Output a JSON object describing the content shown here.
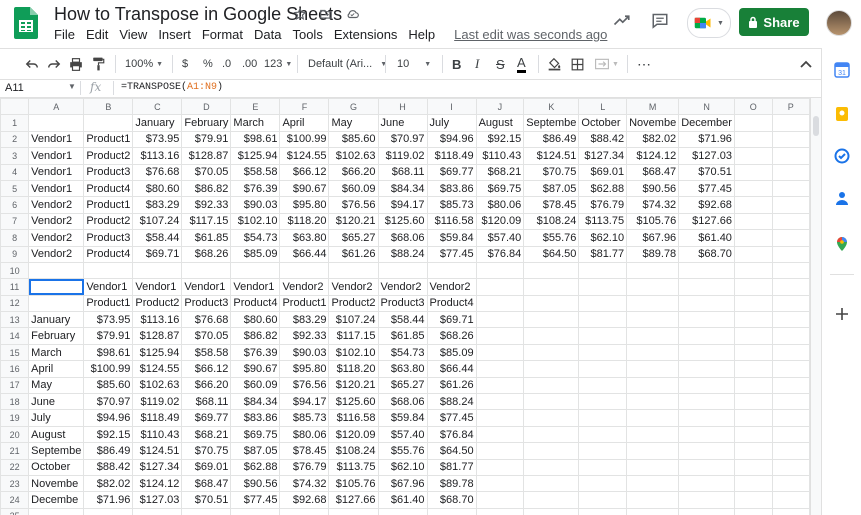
{
  "app": {
    "doc_title": "How to Transpose in Google Sheets",
    "menu": [
      "File",
      "Edit",
      "View",
      "Insert",
      "Format",
      "Data",
      "Tools",
      "Extensions",
      "Help"
    ],
    "last_edit": "Last edit was seconds ago",
    "share_label": "Share",
    "accent_color": "#188038"
  },
  "toolbar": {
    "zoom": "100%",
    "currency": "$",
    "percent": "%",
    "dec_decrease": ".0",
    "dec_increase": ".00",
    "more_formats": "123",
    "font": "Default (Ari...",
    "font_size": "10",
    "bold": "B",
    "italic": "I",
    "strike": "S",
    "text_color": "A"
  },
  "formula_bar": {
    "name_box": "A11",
    "fx": "fx",
    "formula_prefix": "=TRANSPOSE(",
    "formula_ref": "A1:N9",
    "formula_suffix": ")"
  },
  "grid": {
    "columns": [
      "A",
      "B",
      "C",
      "D",
      "E",
      "F",
      "G",
      "H",
      "I",
      "J",
      "K",
      "L",
      "M",
      "N",
      "O",
      "P"
    ],
    "selected_cell": "A11",
    "rows": [
      [
        "",
        "",
        "January",
        "February",
        "March",
        "April",
        "May",
        "June",
        "July",
        "August",
        "Septembe",
        "October",
        "Novembe",
        "December",
        "",
        ""
      ],
      [
        "Vendor1",
        "Product1",
        "$73.95",
        "$79.91",
        "$98.61",
        "$100.99",
        "$85.60",
        "$70.97",
        "$94.96",
        "$92.15",
        "$86.49",
        "$88.42",
        "$82.02",
        "$71.96",
        "",
        ""
      ],
      [
        "Vendor1",
        "Product2",
        "$113.16",
        "$128.87",
        "$125.94",
        "$124.55",
        "$102.63",
        "$119.02",
        "$118.49",
        "$110.43",
        "$124.51",
        "$127.34",
        "$124.12",
        "$127.03",
        "",
        ""
      ],
      [
        "Vendor1",
        "Product3",
        "$76.68",
        "$70.05",
        "$58.58",
        "$66.12",
        "$66.20",
        "$68.11",
        "$69.77",
        "$68.21",
        "$70.75",
        "$69.01",
        "$68.47",
        "$70.51",
        "",
        ""
      ],
      [
        "Vendor1",
        "Product4",
        "$80.60",
        "$86.82",
        "$76.39",
        "$90.67",
        "$60.09",
        "$84.34",
        "$83.86",
        "$69.75",
        "$87.05",
        "$62.88",
        "$90.56",
        "$77.45",
        "",
        ""
      ],
      [
        "Vendor2",
        "Product1",
        "$83.29",
        "$92.33",
        "$90.03",
        "$95.80",
        "$76.56",
        "$94.17",
        "$85.73",
        "$80.06",
        "$78.45",
        "$76.79",
        "$74.32",
        "$92.68",
        "",
        ""
      ],
      [
        "Vendor2",
        "Product2",
        "$107.24",
        "$117.15",
        "$102.10",
        "$118.20",
        "$120.21",
        "$125.60",
        "$116.58",
        "$120.09",
        "$108.24",
        "$113.75",
        "$105.76",
        "$127.66",
        "",
        ""
      ],
      [
        "Vendor2",
        "Product3",
        "$58.44",
        "$61.85",
        "$54.73",
        "$63.80",
        "$65.27",
        "$68.06",
        "$59.84",
        "$57.40",
        "$55.76",
        "$62.10",
        "$67.96",
        "$61.40",
        "",
        ""
      ],
      [
        "Vendor2",
        "Product4",
        "$69.71",
        "$68.26",
        "$85.09",
        "$66.44",
        "$61.26",
        "$88.24",
        "$77.45",
        "$76.84",
        "$64.50",
        "$81.77",
        "$89.78",
        "$68.70",
        "",
        ""
      ],
      [
        "",
        "",
        "",
        "",
        "",
        "",
        "",
        "",
        "",
        "",
        "",
        "",
        "",
        "",
        "",
        ""
      ],
      [
        "",
        "Vendor1",
        "Vendor1",
        "Vendor1",
        "Vendor1",
        "Vendor2",
        "Vendor2",
        "Vendor2",
        "Vendor2",
        "",
        "",
        "",
        "",
        "",
        "",
        ""
      ],
      [
        "",
        "Product1",
        "Product2",
        "Product3",
        "Product4",
        "Product1",
        "Product2",
        "Product3",
        "Product4",
        "",
        "",
        "",
        "",
        "",
        "",
        ""
      ],
      [
        "January",
        "$73.95",
        "$113.16",
        "$76.68",
        "$80.60",
        "$83.29",
        "$107.24",
        "$58.44",
        "$69.71",
        "",
        "",
        "",
        "",
        "",
        "",
        ""
      ],
      [
        "February",
        "$79.91",
        "$128.87",
        "$70.05",
        "$86.82",
        "$92.33",
        "$117.15",
        "$61.85",
        "$68.26",
        "",
        "",
        "",
        "",
        "",
        "",
        ""
      ],
      [
        "March",
        "$98.61",
        "$125.94",
        "$58.58",
        "$76.39",
        "$90.03",
        "$102.10",
        "$54.73",
        "$85.09",
        "",
        "",
        "",
        "",
        "",
        "",
        ""
      ],
      [
        "April",
        "$100.99",
        "$124.55",
        "$66.12",
        "$90.67",
        "$95.80",
        "$118.20",
        "$63.80",
        "$66.44",
        "",
        "",
        "",
        "",
        "",
        "",
        ""
      ],
      [
        "May",
        "$85.60",
        "$102.63",
        "$66.20",
        "$60.09",
        "$76.56",
        "$120.21",
        "$65.27",
        "$61.26",
        "",
        "",
        "",
        "",
        "",
        "",
        ""
      ],
      [
        "June",
        "$70.97",
        "$119.02",
        "$68.11",
        "$84.34",
        "$94.17",
        "$125.60",
        "$68.06",
        "$88.24",
        "",
        "",
        "",
        "",
        "",
        "",
        ""
      ],
      [
        "July",
        "$94.96",
        "$118.49",
        "$69.77",
        "$83.86",
        "$85.73",
        "$116.58",
        "$59.84",
        "$77.45",
        "",
        "",
        "",
        "",
        "",
        "",
        ""
      ],
      [
        "August",
        "$92.15",
        "$110.43",
        "$68.21",
        "$69.75",
        "$80.06",
        "$120.09",
        "$57.40",
        "$76.84",
        "",
        "",
        "",
        "",
        "",
        "",
        ""
      ],
      [
        "Septembe",
        "$86.49",
        "$124.51",
        "$70.75",
        "$87.05",
        "$78.45",
        "$108.24",
        "$55.76",
        "$64.50",
        "",
        "",
        "",
        "",
        "",
        "",
        ""
      ],
      [
        "October",
        "$88.42",
        "$127.34",
        "$69.01",
        "$62.88",
        "$76.79",
        "$113.75",
        "$62.10",
        "$81.77",
        "",
        "",
        "",
        "",
        "",
        "",
        ""
      ],
      [
        "Novembe",
        "$82.02",
        "$124.12",
        "$68.47",
        "$90.56",
        "$74.32",
        "$105.76",
        "$67.96",
        "$89.78",
        "",
        "",
        "",
        "",
        "",
        "",
        ""
      ],
      [
        "Decembe",
        "$71.96",
        "$127.03",
        "$70.51",
        "$77.45",
        "$92.68",
        "$127.66",
        "$61.40",
        "$68.70",
        "",
        "",
        "",
        "",
        "",
        "",
        ""
      ],
      [
        "",
        "",
        "",
        "",
        "",
        "",
        "",
        "",
        "",
        "",
        "",
        "",
        "",
        "",
        "",
        ""
      ]
    ]
  }
}
